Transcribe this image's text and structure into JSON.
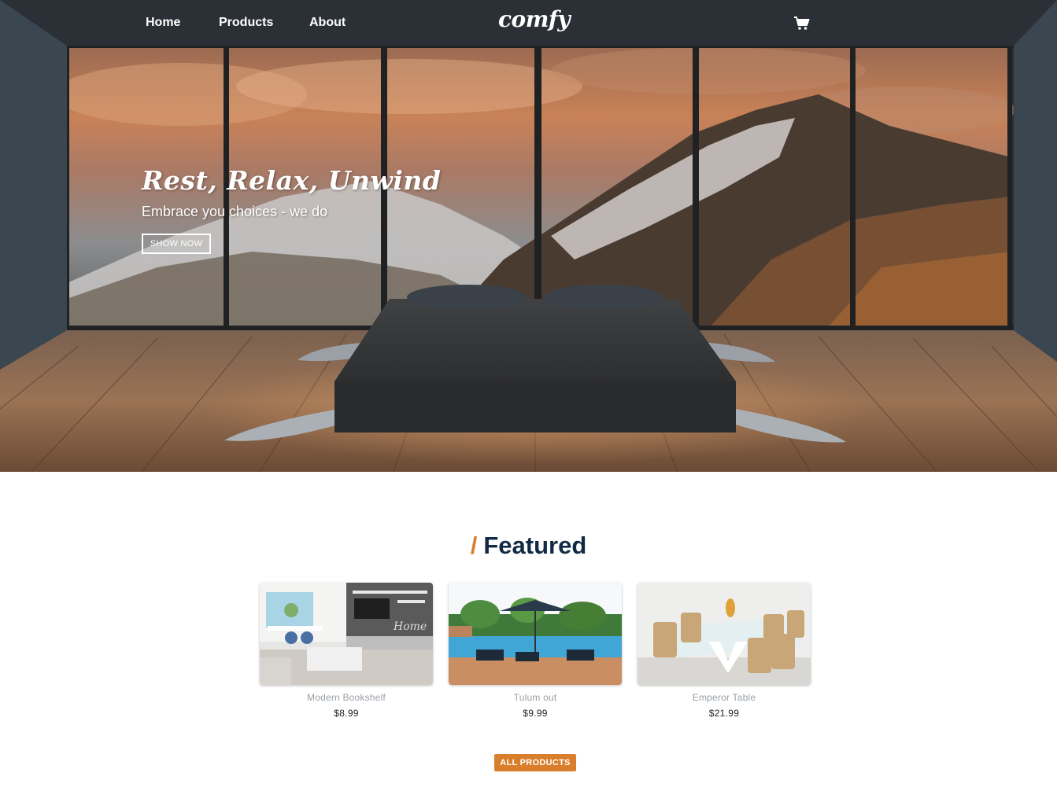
{
  "nav": {
    "links": [
      "Home",
      "Products",
      "About"
    ],
    "logo": "comfy",
    "cart_icon": "cart-icon"
  },
  "hero": {
    "title": "Rest, Relax, Unwind",
    "subtitle": "Embrace you choices - we do",
    "button_label": "SHOW NOW"
  },
  "featured": {
    "slash": "/",
    "title": "Featured",
    "products": [
      {
        "name": "Modern Bookshelf",
        "price": "$8.99"
      },
      {
        "name": "Tulum out",
        "price": "$9.99"
      },
      {
        "name": "Emperor Table",
        "price": "$21.99"
      }
    ],
    "all_button_label": "ALL PRODUCTS"
  },
  "colors": {
    "accent": "#d97e2c",
    "heading": "#102a43",
    "muted_text": "#9aa0a6"
  }
}
